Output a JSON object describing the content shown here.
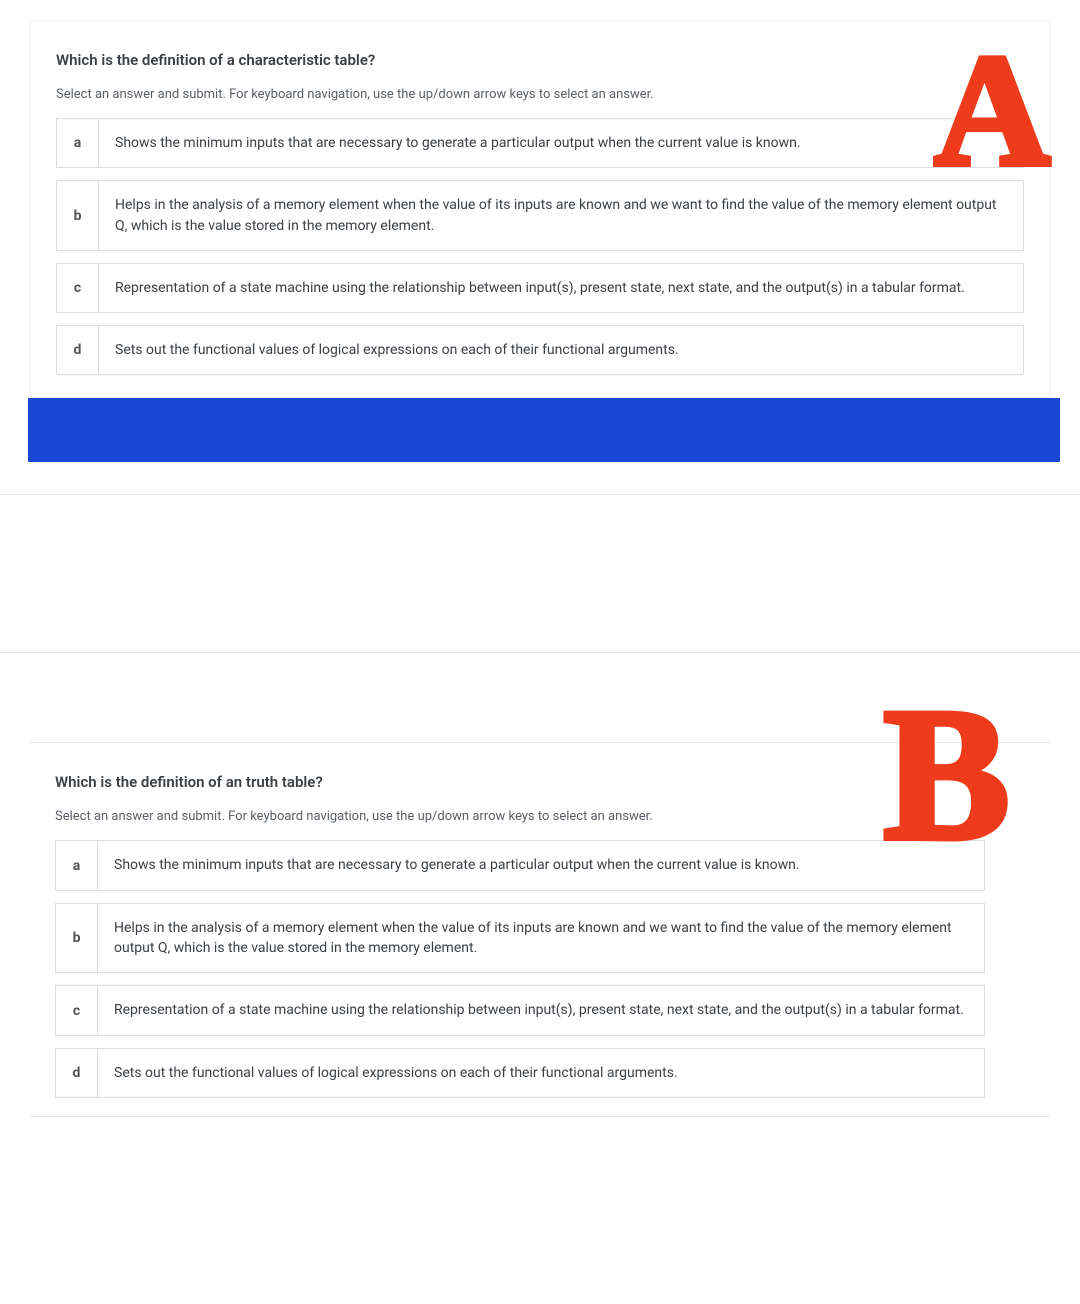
{
  "annotations": {
    "a": "A",
    "b": "B"
  },
  "question1": {
    "title": "Which is the definition of a characteristic table?",
    "instruction": "Select an answer and submit. For keyboard navigation, use the up/down arrow keys to select an answer.",
    "options": [
      {
        "letter": "a",
        "text": "Shows the minimum inputs that are necessary to generate a particular output when the current value is known."
      },
      {
        "letter": "b",
        "text": "Helps in the analysis of a memory element when the value of its inputs are known and we want to find the value of the memory element output Q, which is the value stored in the memory element."
      },
      {
        "letter": "c",
        "text": "Representation of a state machine using the relationship between input(s), present state, next state, and the output(s) in a tabular format."
      },
      {
        "letter": "d",
        "text": "Sets out the functional values of logical expressions on each of their functional arguments."
      }
    ]
  },
  "question2": {
    "title": "Which is the definition of an truth table?",
    "instruction": "Select an answer and submit. For keyboard navigation, use the up/down arrow keys to select an answer.",
    "options": [
      {
        "letter": "a",
        "text": "Shows the minimum inputs that are necessary to generate a particular output when the current value is known."
      },
      {
        "letter": "b",
        "text": "Helps in the analysis of a memory element when the value of its inputs are known and we want to find the value of the memory element output Q, which is the value stored in the memory element."
      },
      {
        "letter": "c",
        "text": "Representation of a state machine using the relationship between input(s), present state, next state, and the output(s) in a tabular format."
      },
      {
        "letter": "d",
        "text": "Sets out the functional values of logical expressions on each of their functional arguments."
      }
    ]
  }
}
